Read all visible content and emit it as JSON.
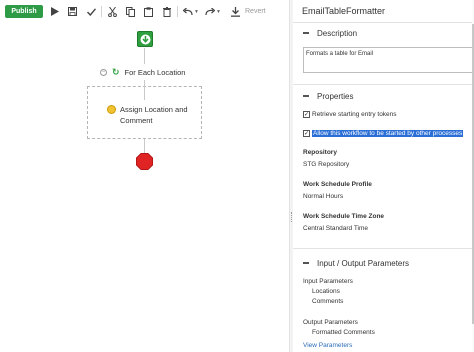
{
  "toolbar": {
    "publish_label": "Publish",
    "revert_label": "Revert",
    "icons": [
      "play-icon",
      "save-icon",
      "check-icon",
      "cut-icon",
      "copy-icon",
      "paste-icon",
      "delete-icon",
      "undo-icon",
      "redo-icon",
      "download-icon"
    ],
    "accent_color": "#2f9b46"
  },
  "canvas": {
    "loop_label": "For Each Location",
    "assign_label": "Assign Location and Comment",
    "start_color": "#2e9e3e",
    "stop_color": "#e02424"
  },
  "panel": {
    "title": "EmailTableFormatter",
    "description": {
      "header": "Description",
      "value": "Formats a table for Email"
    },
    "properties": {
      "header": "Properties",
      "retrieve_label": "Retrieve starting entry tokens",
      "retrieve_checked": true,
      "allow_label": "Allow this workflow to be started by other processes",
      "allow_checked": true,
      "repository_label": "Repository",
      "repository_value": "STG Repository",
      "schedule_label": "Work Schedule Profile",
      "schedule_value": "Normal Hours",
      "timezone_label": "Work Schedule Time Zone",
      "timezone_value": "Central Standard Time"
    },
    "io": {
      "header": "Input / Output Parameters",
      "input_label": "Input Parameters",
      "inputs": [
        "Locations",
        "Comments"
      ],
      "output_label": "Output Parameters",
      "outputs": [
        "Formatted Comments"
      ],
      "view_link": "View Parameters"
    }
  }
}
